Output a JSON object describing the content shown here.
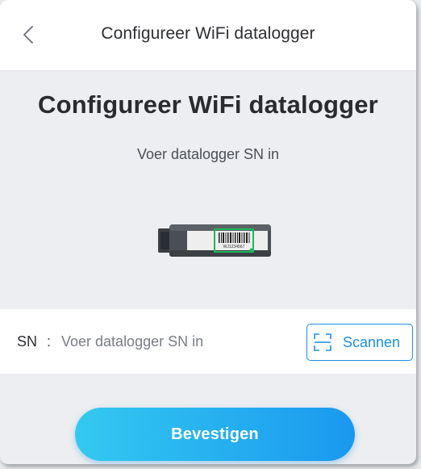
{
  "header": {
    "title": "Configureer WiFi datalogger",
    "back_icon": "chevron-left-icon"
  },
  "main": {
    "title": "Configureer WiFi datalogger",
    "subtitle": "Voer datalogger SN in",
    "device_image": "wifi-datalogger-stick",
    "device_sn_text": "WJ1234567"
  },
  "sn_field": {
    "label": "SN",
    "separator": ":",
    "placeholder": "Voer datalogger SN in",
    "value": ""
  },
  "scan_button": {
    "label": "Scannen",
    "icon": "scan-icon"
  },
  "confirm_button": {
    "label": "Bevestigen"
  },
  "colors": {
    "accent": "#1c8ee8",
    "button_gradient_start": "#33c9f0",
    "button_gradient_end": "#1a98ef",
    "background": "#eceef1",
    "surface": "#ffffff",
    "device_frame": "#1eb85a"
  }
}
